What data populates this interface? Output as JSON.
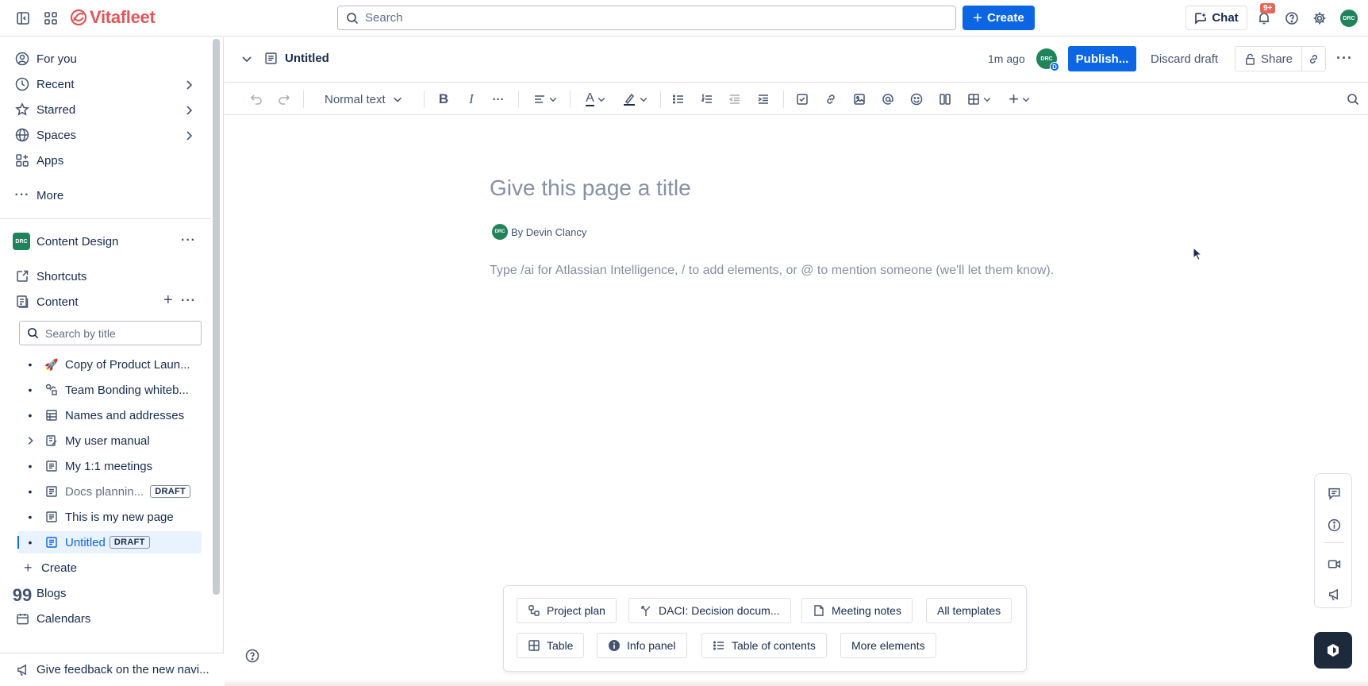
{
  "topbar": {
    "brand": "Vitafleet",
    "search_placeholder": "Search",
    "create_label": "Create",
    "chat_label": "Chat",
    "notification_badge": "9+",
    "avatar_initials": "DRC"
  },
  "sidebar": {
    "nav": [
      {
        "label": "For you",
        "icon": "person-circle-icon"
      },
      {
        "label": "Recent",
        "icon": "clock-icon"
      },
      {
        "label": "Starred",
        "icon": "star-icon"
      },
      {
        "label": "Spaces",
        "icon": "globe-icon"
      },
      {
        "label": "Apps",
        "icon": "apps-icon"
      },
      {
        "label": "More",
        "icon": "more-icon"
      }
    ],
    "space": {
      "name": "Content Design",
      "initials": "DRC"
    },
    "shortcuts_label": "Shortcuts",
    "content_label": "Content",
    "search_placeholder": "Search by title",
    "tree": [
      {
        "label": "Copy of Product Laun...",
        "icon": "rocket-icon"
      },
      {
        "label": "Team Bonding whiteb...",
        "icon": "whiteboard-icon"
      },
      {
        "label": "Names and addresses",
        "icon": "database-icon"
      },
      {
        "label": "My user manual",
        "icon": "page-edit-icon"
      },
      {
        "label": "My 1:1 meetings",
        "icon": "page-icon"
      },
      {
        "label": "Docs plannin...",
        "icon": "page-icon",
        "tag": "DRAFT"
      },
      {
        "label": "This is my new page",
        "icon": "page-icon"
      },
      {
        "label": "Untitled",
        "icon": "page-icon",
        "tag": "DRAFT"
      }
    ],
    "create_label": "Create",
    "blogs_label": "Blogs",
    "calendars_label": "Calendars",
    "feedback_label": "Give feedback on the new navi..."
  },
  "page": {
    "breadcrumb_title": "Untitled",
    "last_edit": "1m ago",
    "editor_avatar": "DRC",
    "editor_avatar_badge": "D",
    "publish_label": "Publish...",
    "discard_label": "Discard draft",
    "share_label": "Share",
    "title_placeholder": "Give this page a title",
    "byline": "By Devin Clancy",
    "byline_avatar": "DRC",
    "body_placeholder": "Type /ai for Atlassian Intelligence, / to add elements, or @ to mention someone (we'll let them know)."
  },
  "toolbar": {
    "text_style": "Normal text"
  },
  "templates": {
    "row1": [
      {
        "label": "Project plan",
        "icon": "project-plan-icon"
      },
      {
        "label": "DACI: Decision docum...",
        "icon": "decision-icon"
      },
      {
        "label": "Meeting notes",
        "icon": "page-icon"
      },
      {
        "label": "All templates",
        "icon": ""
      }
    ],
    "row2": [
      {
        "label": "Table",
        "icon": "table-icon"
      },
      {
        "label": "Info panel",
        "icon": "info-icon"
      },
      {
        "label": "Table of contents",
        "icon": "list-icon"
      },
      {
        "label": "More elements",
        "icon": ""
      }
    ]
  },
  "colors": {
    "brand": "#e0565b",
    "primary": "#0c66e4",
    "avatar": "#1f845a",
    "selected_bg": "#e9f2ff"
  }
}
